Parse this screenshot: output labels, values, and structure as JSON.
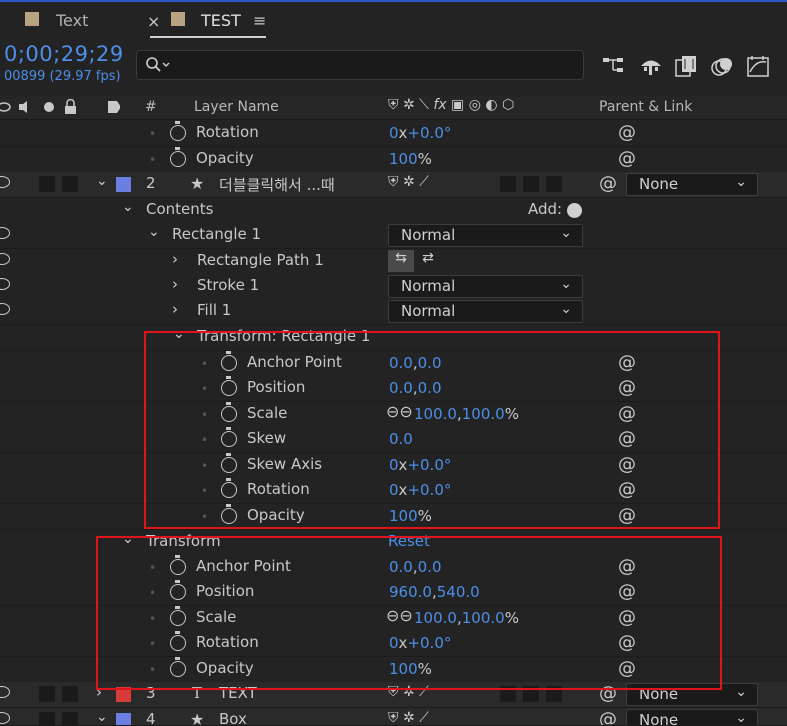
{
  "tabs": [
    {
      "label": "Text"
    },
    {
      "label": "TEST",
      "menu": "≡"
    }
  ],
  "timecode": "0;00;29;29",
  "fps": "00899 (29.97 fps)",
  "search": {
    "icon": "search-icon"
  },
  "header": {
    "num": "#",
    "layer_name": "Layer Name",
    "parent_link": "Parent & Link"
  },
  "rows": {
    "r1": {
      "label": "Rotation",
      "val_a": "0",
      "val_x": "x",
      "val_b": "+0.0°"
    },
    "r2": {
      "label": "Opacity",
      "val_a": "100",
      "val_unit": "%"
    },
    "layer2": {
      "num": "2",
      "name": "더블클릭해서 ...때",
      "parent": "None"
    },
    "contents": {
      "label": "Contents",
      "add": "Add:"
    },
    "rect1": {
      "label": "Rectangle 1",
      "mode": "Normal"
    },
    "rectpath": {
      "label": "Rectangle Path 1"
    },
    "stroke": {
      "label": "Stroke 1",
      "mode": "Normal"
    },
    "fill": {
      "label": "Fill 1",
      "mode": "Normal"
    },
    "tr_rect": {
      "label": "Transform: Rectangle 1"
    },
    "tr_anchor": {
      "label": "Anchor Point",
      "val": "0.0",
      "val2": "0.0"
    },
    "tr_pos": {
      "label": "Position",
      "val": "0.0",
      "val2": "0.0"
    },
    "tr_scale": {
      "label": "Scale",
      "val": "100.0",
      "val2": "100.0",
      "unit": "%"
    },
    "tr_skew": {
      "label": "Skew",
      "val": "0.0"
    },
    "tr_skewaxis": {
      "label": "Skew Axis",
      "val_a": "0",
      "val_x": "x",
      "val_b": "+0.0°"
    },
    "tr_rot": {
      "label": "Rotation",
      "val_a": "0",
      "val_x": "x",
      "val_b": "+0.0°"
    },
    "tr_op": {
      "label": "Opacity",
      "val": "100",
      "unit": "%"
    },
    "transform": {
      "label": "Transform",
      "reset": "Reset"
    },
    "t_anchor": {
      "label": "Anchor Point",
      "val": "0.0",
      "val2": "0.0"
    },
    "t_pos": {
      "label": "Position",
      "val": "960.0",
      "val2": "540.0"
    },
    "t_scale": {
      "label": "Scale",
      "val": "100.0",
      "val2": "100.0",
      "unit": "%"
    },
    "t_rot": {
      "label": "Rotation",
      "val_a": "0",
      "val_x": "x",
      "val_b": "+0.0°"
    },
    "t_op": {
      "label": "Opacity",
      "val": "100",
      "unit": "%"
    },
    "layer3": {
      "num": "3",
      "name": "TEXT",
      "parent": "None"
    },
    "layer4": {
      "num": "4",
      "name": "Box",
      "parent": "None"
    }
  },
  "colors": {
    "accent_blue": "#4d8fe8",
    "highlight_red": "#e0141a",
    "label_blue": "#6b7fe0",
    "label_red": "#d83a3a"
  }
}
